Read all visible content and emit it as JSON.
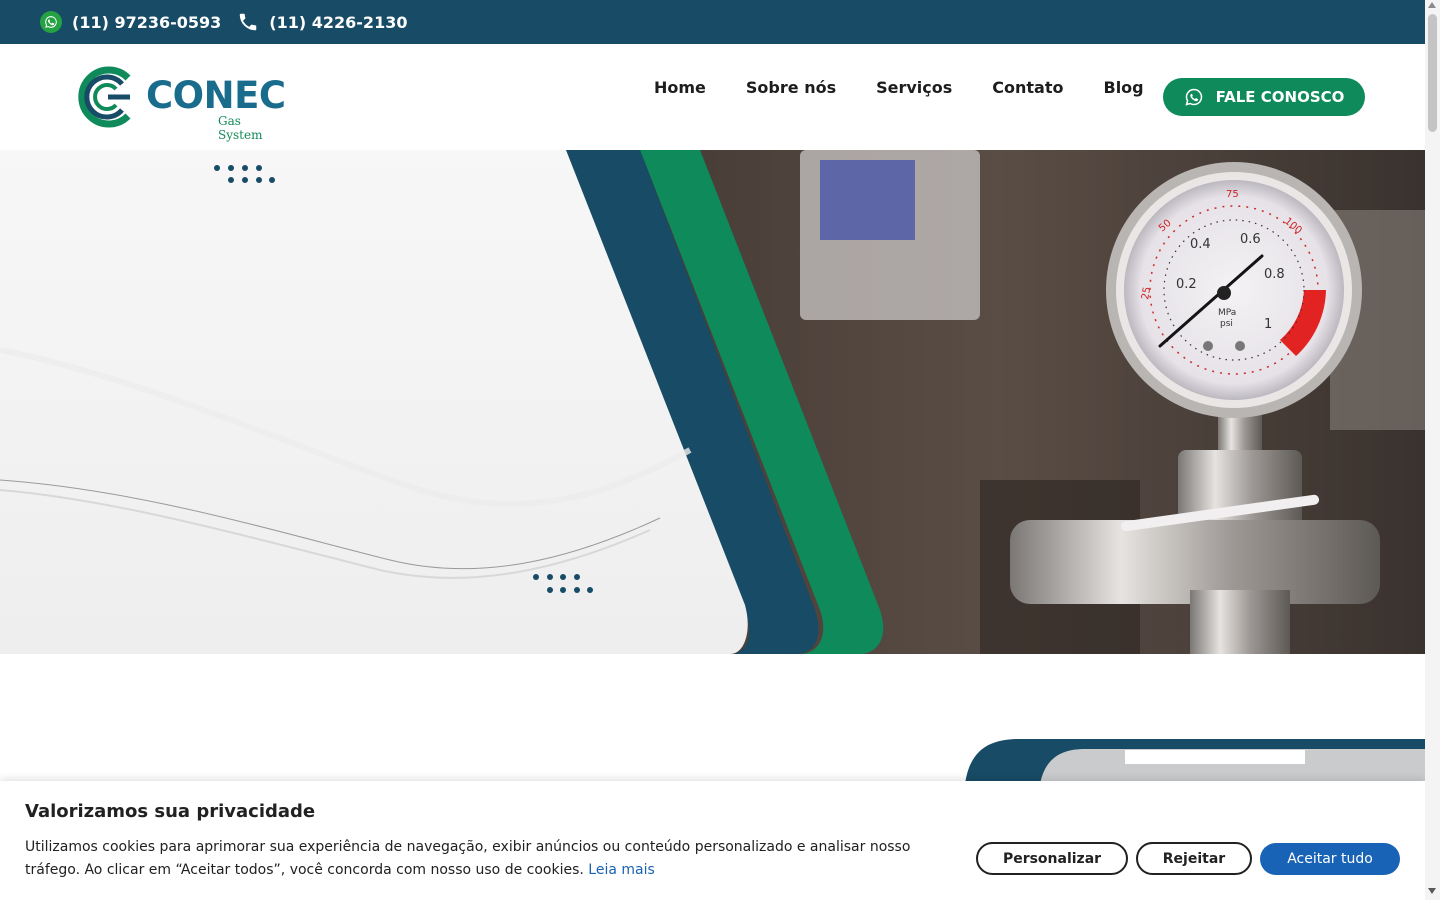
{
  "topbar": {
    "whatsapp_phone": "(11) 97236-0593",
    "landline_phone": "(11) 4226-2130",
    "bg_color": "#174b66"
  },
  "header": {
    "logo_name": "CONEC",
    "logo_tagline": "Gas System",
    "nav": [
      {
        "label": "Home"
      },
      {
        "label": "Sobre nós"
      },
      {
        "label": "Serviços"
      },
      {
        "label": "Contato"
      },
      {
        "label": "Blog"
      }
    ],
    "cta_label": "FALE CONOSCO",
    "cta_color": "#0e8a5b"
  },
  "hero": {
    "image_subject": "pressure-gauge",
    "brand_blue": "#174b66",
    "brand_green": "#0e8a5b"
  },
  "cookie": {
    "title": "Valorizamos sua privacidade",
    "text": "Utilizamos cookies para aprimorar sua experiência de navegação, exibir anúncios ou conteúdo personalizado e analisar nosso tráfego. Ao clicar em “Aceitar todos”, você concorda com nosso uso de cookies.",
    "read_more": "Leia mais",
    "customize_label": "Personalizar",
    "reject_label": "Rejeitar",
    "accept_label": "Aceitar tudo",
    "accent_color": "#1863b5"
  },
  "gauge": {
    "ticks": [
      "0.2",
      "0.4",
      "0.6",
      "0.8",
      "1"
    ],
    "outer_ticks": [
      "25",
      "50",
      "75",
      "100"
    ],
    "unit_primary": "MPa",
    "unit_secondary": "psi"
  }
}
